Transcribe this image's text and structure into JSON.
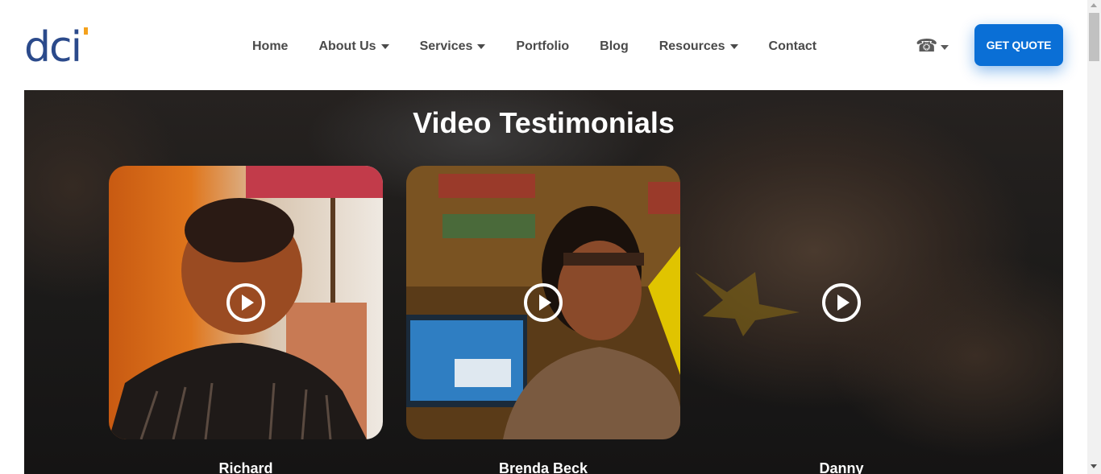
{
  "header": {
    "logo_text": "dci",
    "nav": [
      {
        "label": "Home",
        "has_dropdown": false
      },
      {
        "label": "About Us",
        "has_dropdown": true
      },
      {
        "label": "Services",
        "has_dropdown": true
      },
      {
        "label": "Portfolio",
        "has_dropdown": false
      },
      {
        "label": "Blog",
        "has_dropdown": false
      },
      {
        "label": "Resources",
        "has_dropdown": true
      },
      {
        "label": "Contact",
        "has_dropdown": false
      }
    ],
    "phone_icon": "telephone-icon",
    "cta_label": "GET QUOTE"
  },
  "section": {
    "title": "Video Testimonials",
    "cards": [
      {
        "name": "Richard",
        "icon": "play-icon"
      },
      {
        "name": "Brenda Beck",
        "icon": "play-icon"
      },
      {
        "name": "Danny",
        "icon": "play-icon"
      }
    ]
  },
  "colors": {
    "brand_blue": "#0a6fd6",
    "logo_navy": "#2b4a8b",
    "logo_orange": "#f4a11c",
    "nav_text": "#4a4a4a"
  }
}
